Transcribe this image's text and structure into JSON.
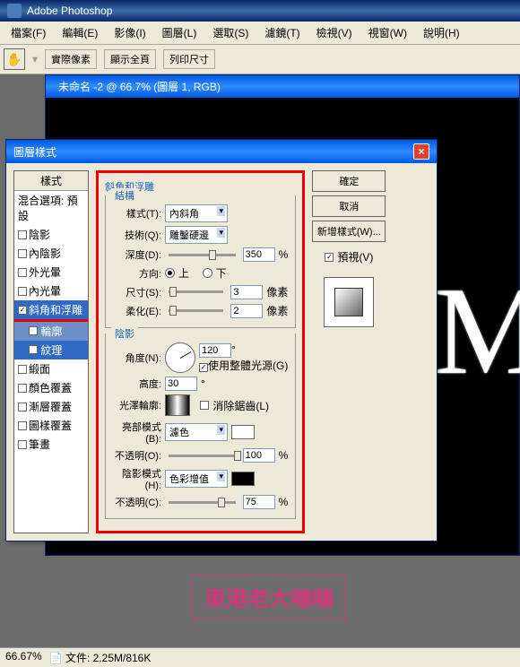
{
  "app": {
    "title": "Adobe Photoshop"
  },
  "menu": [
    "檔案(F)",
    "編輯(E)",
    "影像(I)",
    "圖層(L)",
    "選取(S)",
    "濾鏡(T)",
    "檢視(V)",
    "視窗(W)",
    "說明(H)"
  ],
  "toolbar_buttons": [
    "實際像素",
    "顯示全頁",
    "列印尺寸"
  ],
  "doc": {
    "title": "未命名 -2 @ 66.7% (圖層 1, RGB)"
  },
  "dialog": {
    "title": "圖層樣式",
    "styles_header": "樣式",
    "blend_default": "混合選項: 預設",
    "style_items": [
      {
        "label": "陰影",
        "checked": false
      },
      {
        "label": "內陰影",
        "checked": false
      },
      {
        "label": "外光暈",
        "checked": false
      },
      {
        "label": "內光暈",
        "checked": false
      },
      {
        "label": "斜角和浮雕",
        "checked": true,
        "selected": true
      },
      {
        "label": "輪廓",
        "checked": false,
        "sub": true
      },
      {
        "label": "紋理",
        "checked": false,
        "sub": true,
        "sub_sel": true
      },
      {
        "label": "緞面",
        "checked": false
      },
      {
        "label": "顏色覆蓋",
        "checked": false
      },
      {
        "label": "漸層覆蓋",
        "checked": false
      },
      {
        "label": "圖樣覆蓋",
        "checked": false
      },
      {
        "label": "筆畫",
        "checked": false
      }
    ],
    "section_bevel": "斜角和浮雕",
    "group_structure": "結構",
    "group_shading": "陰影",
    "lbl_style": "樣式(T):",
    "val_style": "內斜角",
    "lbl_tech": "技術(Q):",
    "val_tech": "雕鑿硬邊",
    "lbl_depth": "深度(D):",
    "val_depth": "350",
    "unit_pct": "%",
    "lbl_dir": "方向:",
    "dir_up": "上",
    "dir_down": "下",
    "lbl_size": "尺寸(S):",
    "val_size": "3",
    "unit_px": "像素",
    "lbl_soft": "柔化(E):",
    "val_soft": "2",
    "lbl_angle": "角度(N):",
    "val_angle": "120",
    "deg": "°",
    "lbl_global": "使用整體光源(G)",
    "lbl_alt": "高度:",
    "val_alt": "30",
    "lbl_gloss": "光澤輪廓:",
    "lbl_anti": "消除鋸齒(L)",
    "lbl_hilite": "亮部模式(B):",
    "val_hilite": "濾色",
    "lbl_hopac": "不透明(O):",
    "val_hopac": "100",
    "lbl_shadow": "陰影模式(H):",
    "val_shadow": "色彩增值",
    "lbl_sopac": "不透明(C):",
    "val_sopac": "75",
    "btn_ok": "確定",
    "btn_cancel": "取消",
    "btn_new": "新增樣式(W)...",
    "lbl_preview": "預視(V)"
  },
  "status": {
    "zoom": "66.67%",
    "doc": "文件: 2.25M/816K"
  },
  "watermark": "東港老大嘣嘣"
}
